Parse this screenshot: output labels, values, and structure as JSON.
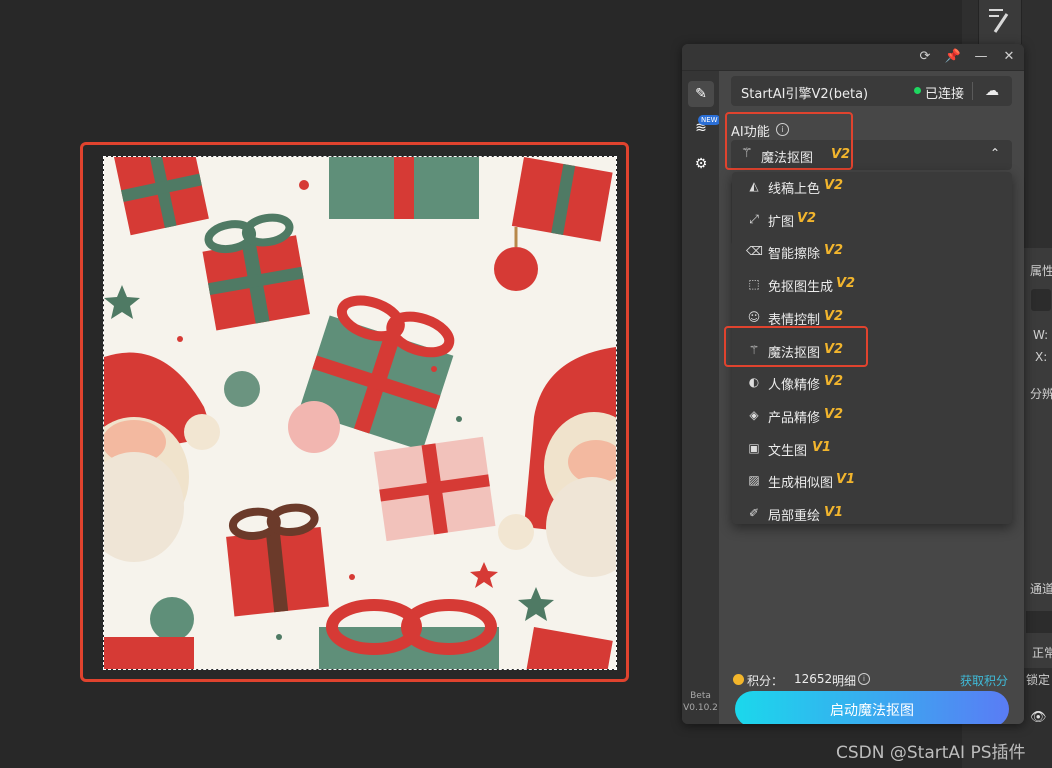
{
  "panel": {
    "titlebar_buttons": [
      "refresh-icon",
      "pin-icon",
      "minimize-icon",
      "close-icon"
    ],
    "version_line1": "Beta",
    "version_line2": "V0.10.2",
    "new_badge": "NEW"
  },
  "engine": {
    "name": "StartAI引擎V2(beta)",
    "status": "已连接",
    "status_color": "#1ed760"
  },
  "ai_section": {
    "label": "AI功能",
    "selected_label": "魔法抠图",
    "selected_version": "V2"
  },
  "dropdown": {
    "items": [
      {
        "label": "线稿上色",
        "version": "V2",
        "icon": "paint-bucket-icon"
      },
      {
        "label": "扩图",
        "version": "V2",
        "icon": "expand-icon"
      },
      {
        "label": "智能擦除",
        "version": "V2",
        "icon": "eraser-icon"
      },
      {
        "label": "免抠图生成",
        "version": "V2",
        "icon": "cutout-generate-icon"
      },
      {
        "label": "表情控制",
        "version": "V2",
        "icon": "smiley-icon"
      },
      {
        "label": "魔法抠图",
        "version": "V2",
        "icon": "magic-wand-icon"
      },
      {
        "label": "人像精修",
        "version": "V2",
        "icon": "portrait-icon"
      },
      {
        "label": "产品精修",
        "version": "V2",
        "icon": "product-icon"
      },
      {
        "label": "文生图",
        "version": "V1",
        "icon": "text-to-image-icon"
      },
      {
        "label": "生成相似图",
        "version": "V1",
        "icon": "similar-image-icon"
      },
      {
        "label": "局部重绘",
        "version": "V1",
        "icon": "brush-icon"
      }
    ]
  },
  "footer": {
    "credits_label": "积分：",
    "credits_value": "12652",
    "detail_label": "明细",
    "get_credits": "获取积分",
    "launch_button": "启动魔法抠图"
  },
  "ps_side": {
    "properties": "属性",
    "w": "W:",
    "x": "X:",
    "resolution": "分辨",
    "channels": "通道",
    "normal": "正常",
    "lock": "锁定"
  },
  "watermark": "CSDN @StartAI PS插件",
  "colors": {
    "accent_highlight": "#e0432e",
    "version_tag": "#f2b52d",
    "link": "#3fbbd8"
  }
}
